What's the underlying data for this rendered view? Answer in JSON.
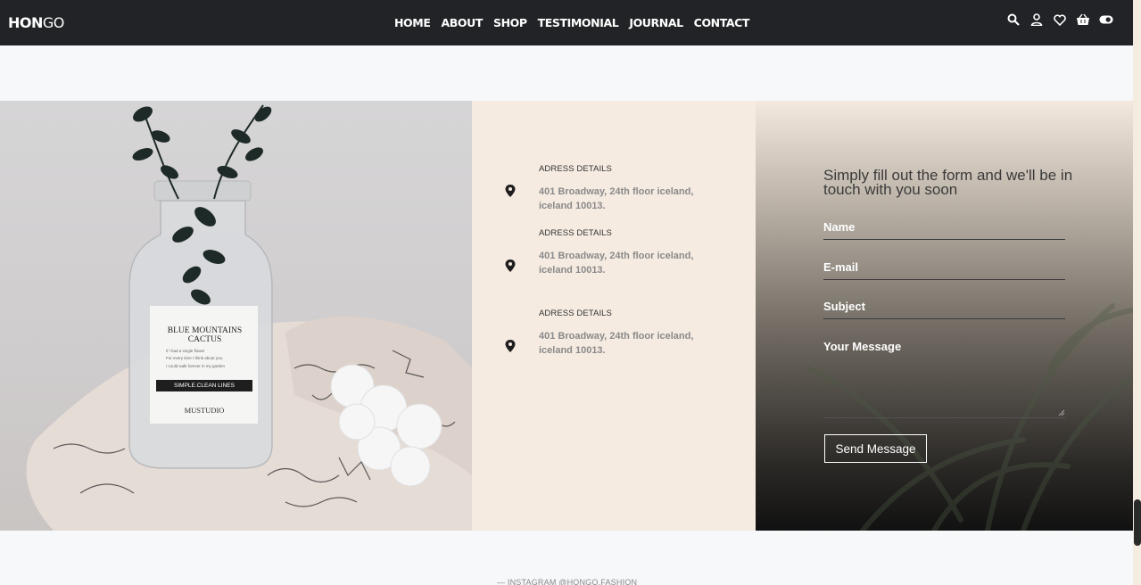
{
  "brand": {
    "bold": "HON",
    "light": "GO"
  },
  "nav": {
    "items": [
      "HOME",
      "ABOUT",
      "SHOP",
      "TESTIMONIAL",
      "JOURNAL",
      "CONTACT"
    ]
  },
  "header_icons": [
    "search-icon",
    "user-icon",
    "heart-icon",
    "basket-icon",
    "toggle-icon"
  ],
  "photo": {
    "label_title": "BLUE MOUNTAINS CACTUS",
    "label_line1": "If i had a single flower",
    "label_line2": "For every time I think about you,",
    "label_line3": "I could walk forever in my garden",
    "label_band": "SIMPLE.CLEAN LINES",
    "label_brand": "MUSTUDIO"
  },
  "addresses": [
    {
      "title": "ADRESS DETAILS",
      "text": "401 Broadway, 24th floor iceland, iceland 10013."
    },
    {
      "title": "ADRESS DETAILS",
      "text": "401 Broadway, 24th floor iceland, iceland 10013."
    },
    {
      "title": "ADRESS DETAILS",
      "text": "401 Broadway, 24th floor iceland, iceland 10013."
    }
  ],
  "form": {
    "heading": "Simply fill out the form and we'll be in touch with you soon",
    "name": "Name",
    "email": "E-mail",
    "subject": "Subject",
    "message": "Your Message",
    "send": "Send Message"
  },
  "footer": {
    "caption": "— INSTAGRAM @HONGO.FASHION"
  },
  "colors": {
    "nav_bg": "#212326",
    "info_bg": "#f5ebe1",
    "page_bg": "#f7f8fa"
  }
}
